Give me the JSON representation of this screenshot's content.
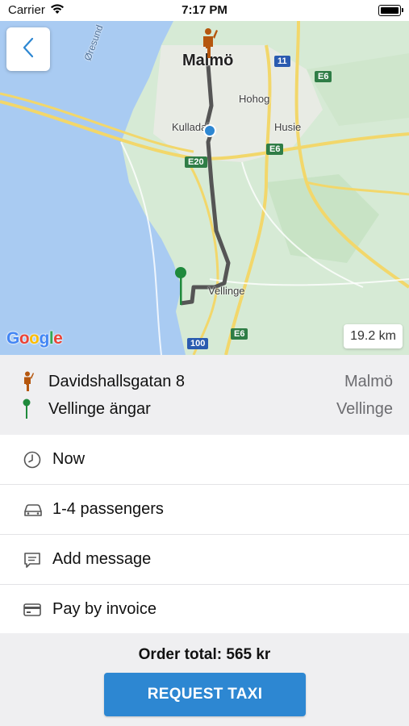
{
  "status_bar": {
    "carrier": "Carrier",
    "time": "7:17 PM"
  },
  "map": {
    "labels": {
      "malmo": "Malmö",
      "hohog": "Hohog",
      "kulladal": "Kulladal",
      "husie": "Husie",
      "vellinge": "Vellinge",
      "oresund": "Øresund"
    },
    "shields": {
      "e6_a": "E6",
      "e6_b": "E6",
      "e6_c": "E6",
      "e20": "E20",
      "r11": "11",
      "r100": "100"
    },
    "distance": "19.2 km",
    "google_logo": "Google"
  },
  "route": {
    "pickup": {
      "street": "Davidshallsgatan 8",
      "city": "Malmö"
    },
    "destination": {
      "street": "Vellinge ängar",
      "city": "Vellinge"
    }
  },
  "options": {
    "time": "Now",
    "passengers": "1-4 passengers",
    "message": "Add message",
    "payment": "Pay by invoice"
  },
  "footer": {
    "order_total": "Order total: 565 kr",
    "request_button": "REQUEST TAXI"
  },
  "colors": {
    "accent": "#2d87d2",
    "pickup_marker": "#b5570f",
    "destination_marker": "#1f8a3c",
    "route_line": "#555555"
  }
}
